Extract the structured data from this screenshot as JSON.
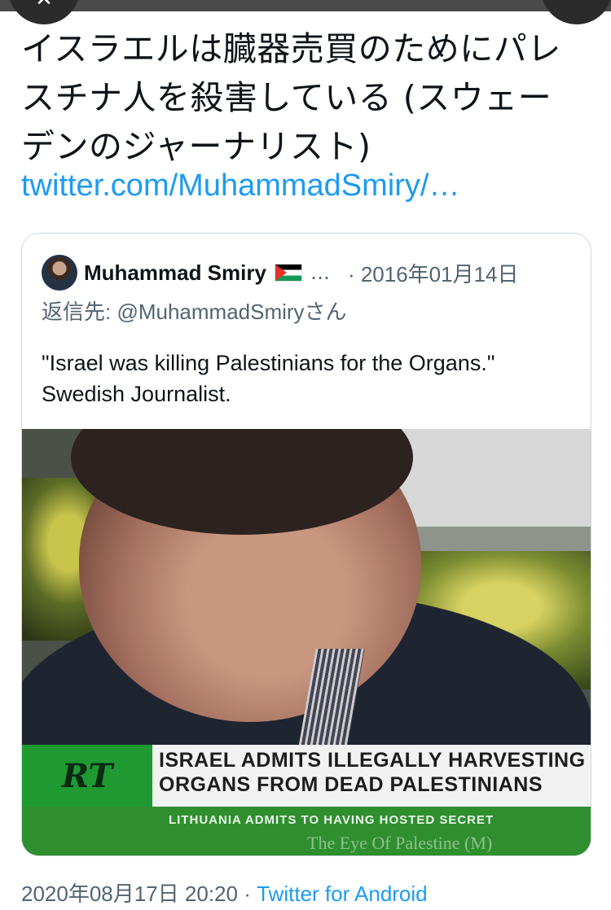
{
  "tweet": {
    "text_lines": [
      "イスラエルは臓器売買のためにパレ",
      "スチナ人を殺害している (スウェー",
      "デンのジャーナリスト)"
    ],
    "link": "twitter.com/MuhammadSmiry/…"
  },
  "quote": {
    "name": "Muhammad Smiry",
    "flag_icon": "palestine-flag",
    "ellipsis": "…",
    "date": "· 2016年01月14日",
    "reply_to": "返信先: @MuhammadSmiryさん",
    "body_lines": [
      "\"Israel was killing Palestinians for the Organs.\"",
      "Swedish Journalist."
    ],
    "video": {
      "logo": "RT",
      "headline_lines": [
        "ISRAEL ADMITS ILLEGALLY HARVESTING",
        "ORGANS FROM DEAD PALESTINIANS"
      ],
      "ticker": "LITHUANIA ADMITS TO HAVING HOSTED SECRET",
      "ticker_sub": "The Eye Of Palestine (M)"
    }
  },
  "footer": {
    "timestamp": "2020年08月17日 20:20 ·",
    "source": "Twitter for Android"
  },
  "colors": {
    "link": "#1d9bf0",
    "secondary_text": "#536471",
    "card_border": "#cfd9de"
  }
}
